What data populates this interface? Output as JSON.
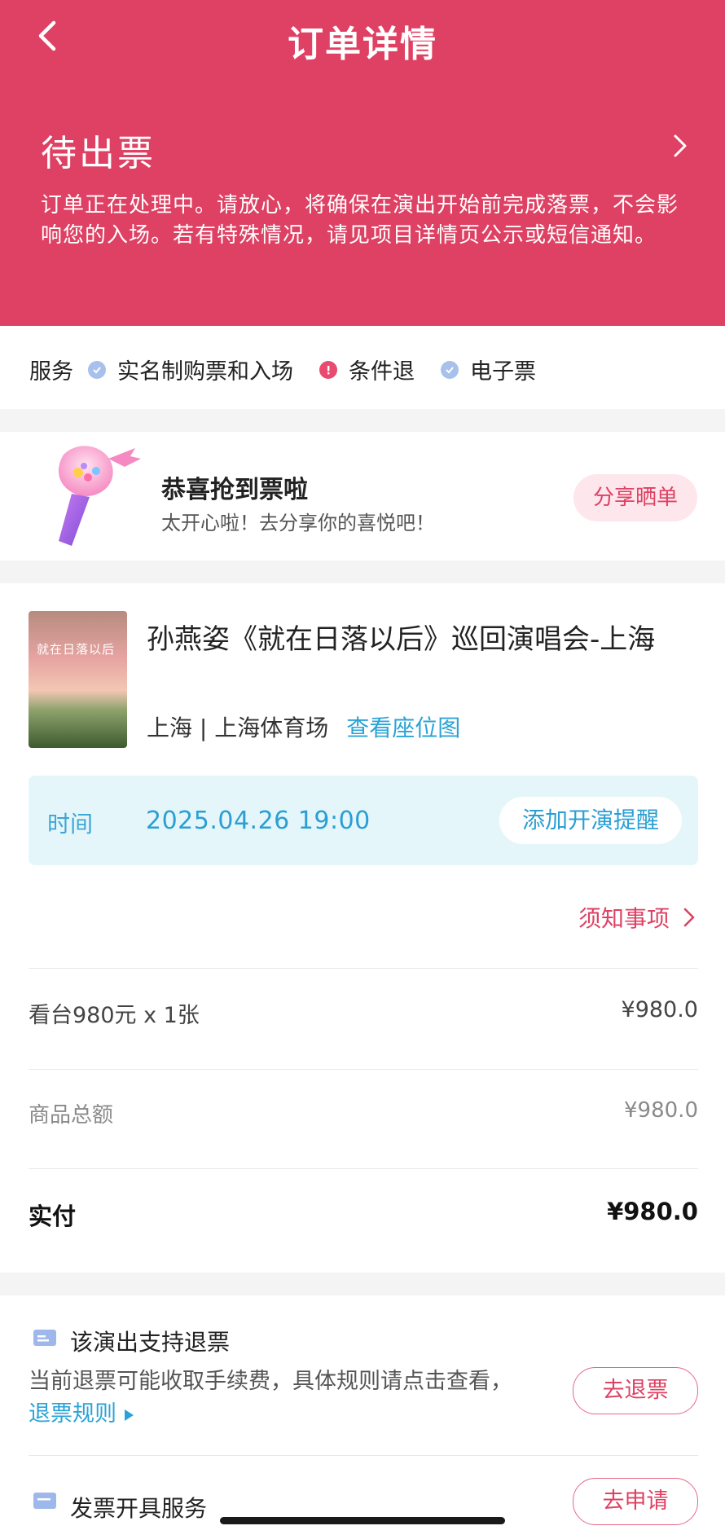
{
  "header": {
    "title": "订单详情",
    "status_title": "待出票",
    "status_desc": "订单正在处理中。请放心，将确保在演出开始前完成落票，不会影响您的入场。若有特殊情况，请见项目详情页公示或短信通知。"
  },
  "services": {
    "label": "服务",
    "items": [
      {
        "label": "实名制购票和入场",
        "icon": "check-circle-icon"
      },
      {
        "label": "条件退",
        "icon": "alert-circle-icon"
      },
      {
        "label": "电子票",
        "icon": "check-circle-icon"
      }
    ]
  },
  "congrats": {
    "title": "恭喜抢到票啦",
    "subtitle": "太开心啦！去分享你的喜悦吧！",
    "share_label": "分享晒单"
  },
  "show": {
    "poster_text": "就在日落以后",
    "title": "孙燕姿《就在日落以后》巡回演唱会-上海",
    "venue": "上海 | 上海体育场",
    "seatmap_label": "查看座位图",
    "time_label": "时间",
    "time_value": "2025.04.26 19:00",
    "reminder_label": "添加开演提醒",
    "notice_label": "须知事项"
  },
  "price": {
    "ticket_label": "看台980元 x 1张",
    "ticket_value": "¥980.0",
    "subtotal_label": "商品总额",
    "subtotal_value": "¥980.0",
    "paid_label": "实付",
    "paid_value": "¥980.0"
  },
  "refund": {
    "title": "该演出支持退票",
    "desc": "当前退票可能收取手续费，具体规则请点击查看，",
    "rules_link": "退票规则",
    "button": "去退票"
  },
  "invoice": {
    "title": "发票开具服务",
    "button": "去申请"
  },
  "colors": {
    "brand": "#de4163",
    "link": "#2aa3d6",
    "time_box": "#e5f6fb"
  }
}
